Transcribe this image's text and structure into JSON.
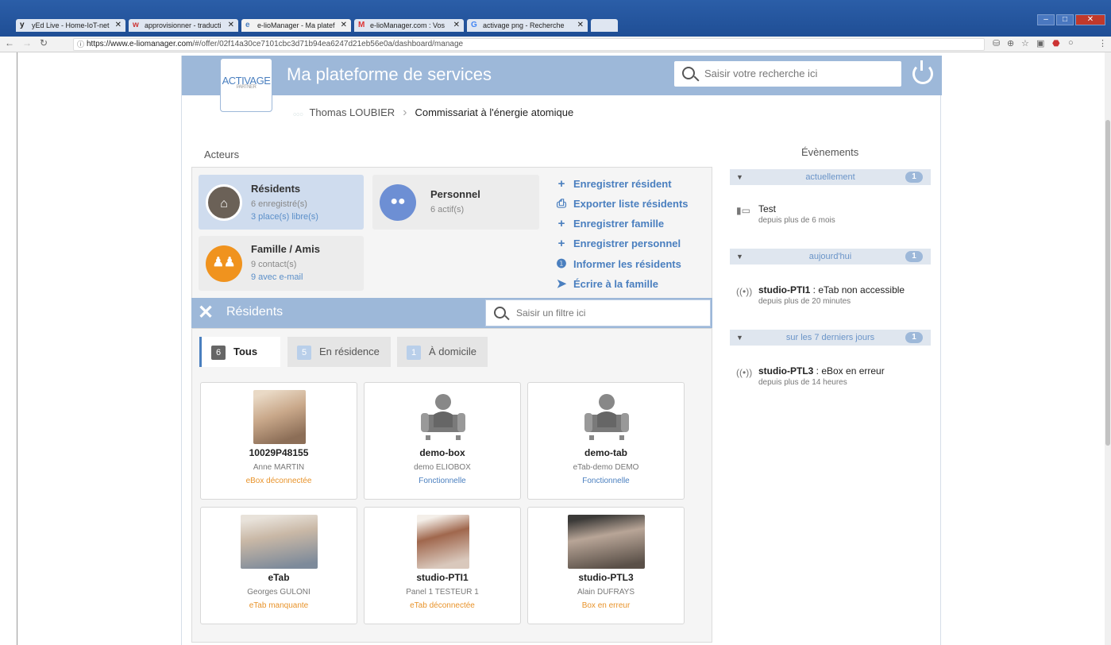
{
  "browser": {
    "tabs": [
      {
        "label": "yEd Live - Home-IoT-net",
        "fav": "y",
        "active": false
      },
      {
        "label": "approvisionner - traducti",
        "fav": "w",
        "active": false
      },
      {
        "label": "e-lioManager - Ma platef",
        "fav": "e",
        "active": true
      },
      {
        "label": "e-lioManager.com : Vos",
        "fav": "M",
        "active": false
      },
      {
        "label": "activage png - Recherche",
        "fav": "G",
        "active": false
      }
    ],
    "url_host": "https://www.e-liomanager.com",
    "url_path": "/#/offer/02f14a30ce7101cbc3d71b94ea6247d21eb56e0a/dashboard/manage"
  },
  "app": {
    "logo_text": "ACTIVAGE",
    "logo_sub": "PARTNER",
    "title": "Ma plateforme de services",
    "search_placeholder": "Saisir votre recherche ici"
  },
  "breadcrumb": {
    "user": "Thomas LOUBIER",
    "org": "Commissariat à l'énergie atomique"
  },
  "acteurs": {
    "label": "Acteurs",
    "cards": {
      "residents": {
        "title": "Résidents",
        "line1": "6 enregistré(s)",
        "line2": "3 place(s) libre(s)"
      },
      "personnel": {
        "title": "Personnel",
        "line1": "6 actif(s)"
      },
      "famille": {
        "title": "Famille / Amis",
        "line1": "9 contact(s)",
        "line2": "9 avec e-mail"
      }
    },
    "actions": [
      "Enregistrer résident",
      "Exporter liste résidents",
      "Enregistrer famille",
      "Enregistrer personnel",
      "Informer les résidents",
      "Écrire à la famille"
    ]
  },
  "residents_panel": {
    "title": "Résidents",
    "filter_placeholder": "Saisir un filtre ici",
    "filters": [
      {
        "count": "6",
        "label": "Tous"
      },
      {
        "count": "5",
        "label": "En résidence"
      },
      {
        "count": "1",
        "label": "À domicile"
      }
    ],
    "cards": [
      {
        "name": "10029P48155",
        "person": "Anne MARTIN",
        "status": "eBox déconnectée",
        "status_color": "#e8932a"
      },
      {
        "name": "demo-box",
        "person": "demo ELIOBOX",
        "status": "Fonctionnelle",
        "status_color": "#4a7fbf"
      },
      {
        "name": "demo-tab",
        "person": "eTab-demo DEMO",
        "status": "Fonctionnelle",
        "status_color": "#4a7fbf"
      },
      {
        "name": "eTab",
        "person": "Georges GULONI",
        "status": "eTab manquante",
        "status_color": "#e8932a"
      },
      {
        "name": "studio-PTI1",
        "person": "Panel 1 TESTEUR 1",
        "status": "eTab déconnectée",
        "status_color": "#e8932a"
      },
      {
        "name": "studio-PTL3",
        "person": "Alain DUFRAYS",
        "status": "Box en erreur",
        "status_color": "#e8932a"
      }
    ]
  },
  "events": {
    "title": "Évènements",
    "groups": [
      {
        "label": "actuellement",
        "count": "1"
      },
      {
        "label": "aujourd'hui",
        "count": "1"
      },
      {
        "label": "sur les 7 derniers jours",
        "count": "1"
      }
    ],
    "items": [
      {
        "device": "",
        "text": "Test",
        "when": "depuis plus de 6 mois"
      },
      {
        "device": "studio-PTI1",
        "text": " : eTab non accessible",
        "when": "depuis plus de 20 minutes"
      },
      {
        "device": "studio-PTL3",
        "text": " : eBox en erreur",
        "when": "depuis plus de 14 heures"
      }
    ]
  },
  "colors": {
    "accent": "#9db8d9",
    "link": "#4a7fbf",
    "warning": "#e8932a",
    "residents_circle": "#6b6157",
    "personnel_circle": "#6d8fd4",
    "famille_circle": "#f0931e"
  }
}
